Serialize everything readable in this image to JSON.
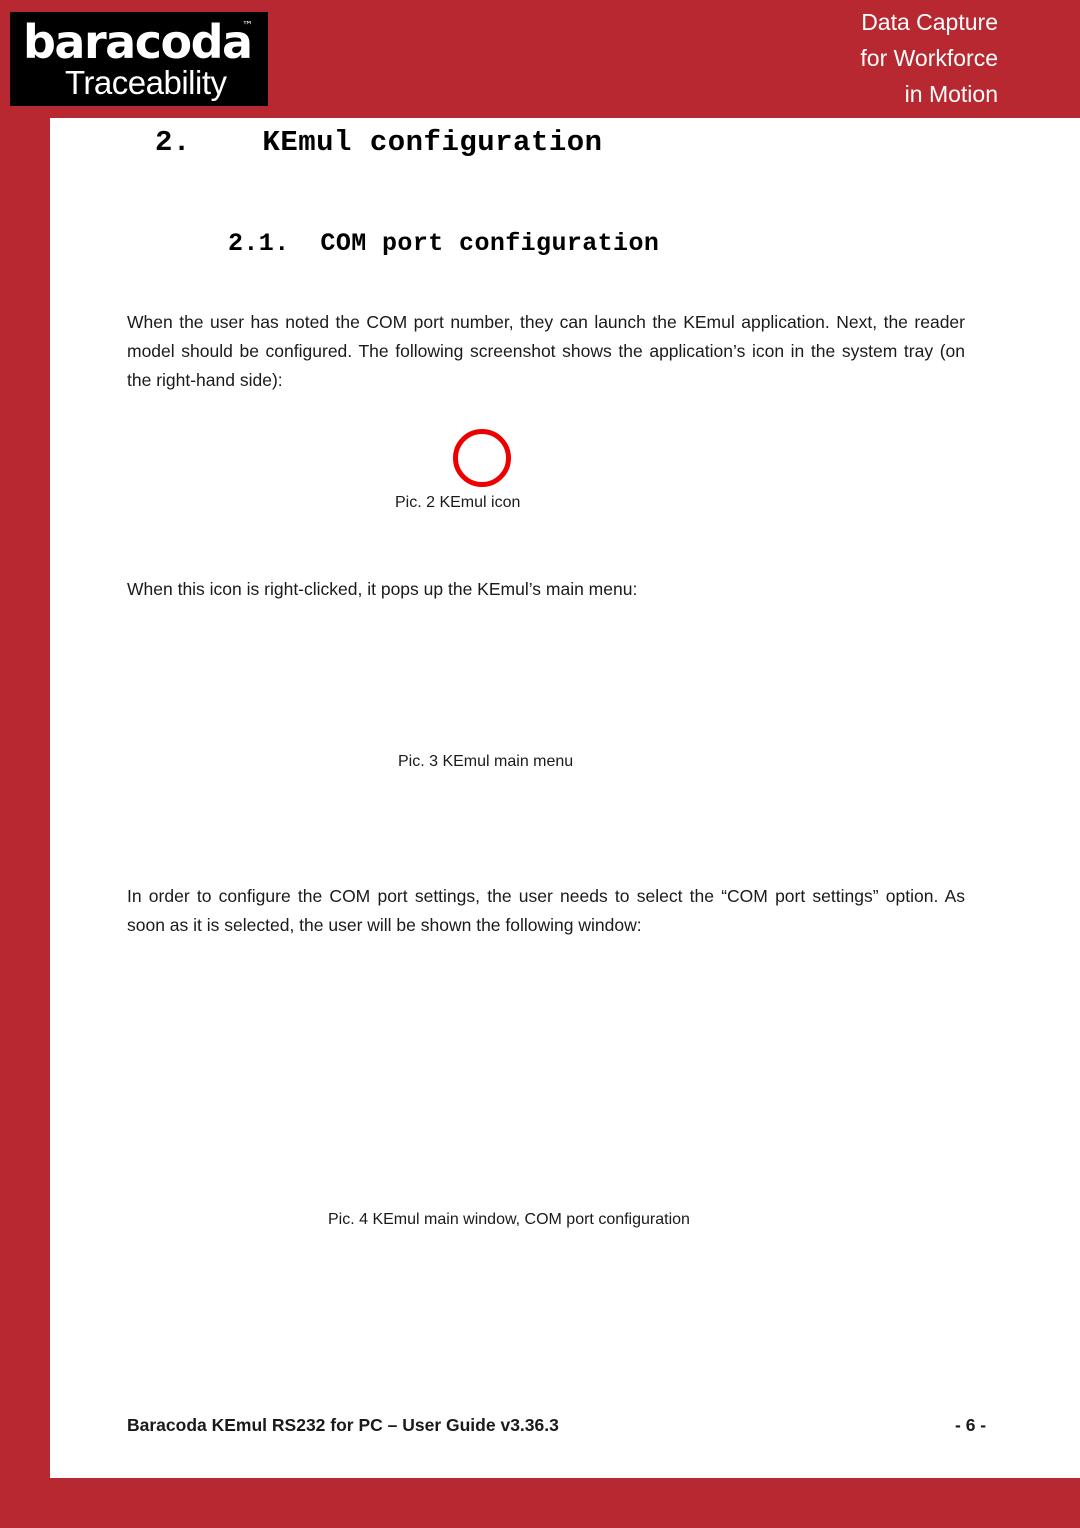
{
  "header": {
    "logo": {
      "brand": "baracoda",
      "trademark": "™",
      "subtitle": "Traceability"
    },
    "tagline": {
      "line1": "Data Capture",
      "line2": "for Workforce",
      "line3": "in Motion"
    }
  },
  "colors": {
    "brand_red": "#b82830",
    "annotation_red": "#ee0000",
    "logo_background": "#000000",
    "page_background": "#ffffff"
  },
  "headings": {
    "section": "2.    KEmul configuration",
    "subsection": "2.1.  COM port configuration"
  },
  "body": {
    "paragraph_1": "When the user has noted the COM port number, they can launch the KEmul application. Next, the reader model should be configured. The following screenshot shows the application’s icon in the system tray (on the right-hand side):",
    "paragraph_2": "When this icon is right-clicked, it pops up the KEmul’s main menu:",
    "paragraph_3": "In order to configure the COM port settings, the user needs to select the “COM port settings” option. As soon as it is selected, the user will be shown the following window:"
  },
  "figures": {
    "caption_2": "Pic. 2 KEmul icon",
    "caption_3": "Pic. 3 KEmul main menu",
    "caption_4": "Pic. 4 KEmul main window, COM port configuration"
  },
  "footer": {
    "document_title": "Baracoda KEmul RS232 for PC – User Guide v3.36.3",
    "page_number": "- 6 -"
  }
}
